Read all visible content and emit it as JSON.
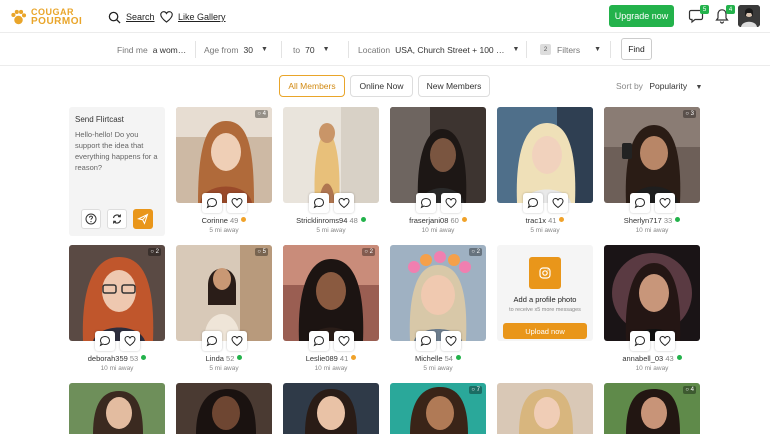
{
  "header": {
    "logo_line1": "COUGAR",
    "logo_line2": "POURMOI",
    "search_label": "Search",
    "gallery_label": "Like Gallery",
    "upgrade_label": "Upgrade now",
    "messages_badge": "5",
    "notifications_badge": "4"
  },
  "filters": {
    "find_me_label": "Find me",
    "find_me_value": "a wom…",
    "age_from_label": "Age from",
    "age_from_value": "30",
    "age_to_label": "to",
    "age_to_value": "70",
    "location_label": "Location",
    "location_value": "USA, Church Street + 100 …",
    "filters_count": "2",
    "filters_label": "Filters",
    "find_button": "Find"
  },
  "tabs": {
    "all": "All Members",
    "online": "Online Now",
    "new": "New Members"
  },
  "sort": {
    "label": "Sort by",
    "value": "Popularity"
  },
  "flirtcast": {
    "title": "Send Flirtcast",
    "text": "Hello-hello! Do you support the idea that everything happens for a reason?"
  },
  "members": [
    {
      "name": "Corinne",
      "age": "49",
      "status": "away",
      "distance": "5 mi away",
      "photos": "4"
    },
    {
      "name": "Stricklinroms94",
      "age": "48",
      "status": "online",
      "distance": "5 mi away",
      "photos": ""
    },
    {
      "name": "fraserjani08",
      "age": "60",
      "status": "away",
      "distance": "10 mi away",
      "photos": ""
    },
    {
      "name": "trac1x",
      "age": "41",
      "status": "away",
      "distance": "5 mi away",
      "photos": ""
    },
    {
      "name": "Sherlyn717",
      "age": "33",
      "status": "online",
      "distance": "10 mi away",
      "photos": "3"
    },
    {
      "name": "deborah359",
      "age": "53",
      "status": "online",
      "distance": "10 mi away",
      "photos": "2"
    },
    {
      "name": "Linda",
      "age": "52",
      "status": "online",
      "distance": "5 mi away",
      "photos": "5"
    },
    {
      "name": "Leslie089",
      "age": "41",
      "status": "away",
      "distance": "10 mi away",
      "photos": "2"
    },
    {
      "name": "Michelle",
      "age": "54",
      "status": "online",
      "distance": "5 mi away",
      "photos": "2"
    },
    {
      "name": "annabell_03",
      "age": "43",
      "status": "online",
      "distance": "10 mi away",
      "photos": ""
    }
  ],
  "bottom_row_photos": [
    "",
    "",
    "",
    "7",
    "",
    "4"
  ],
  "upload": {
    "title": "Add a profile photo",
    "subtitle": "to receive x5 more messages",
    "button": "Upload now"
  },
  "colors": {
    "accent_orange": "#e9961a",
    "online_green": "#23b24b",
    "away_orange": "#f0a22a"
  }
}
